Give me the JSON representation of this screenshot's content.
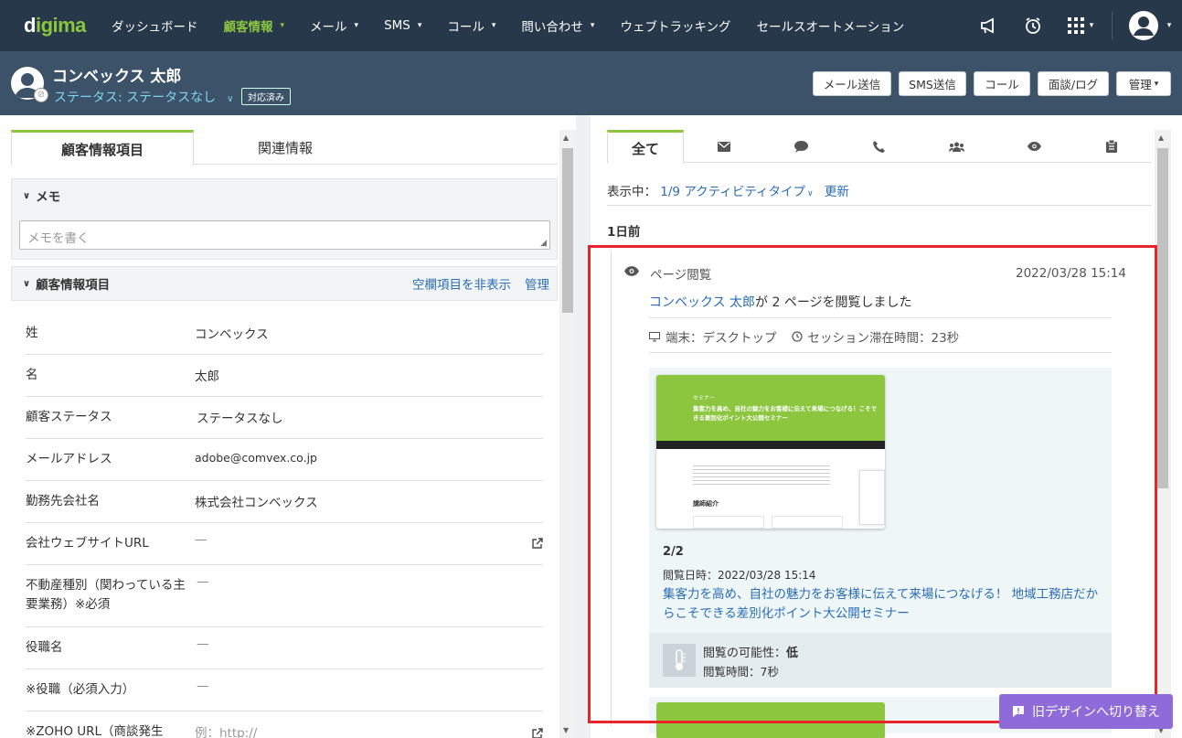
{
  "nav": {
    "logo_a": "d",
    "logo_b": "igima",
    "items": [
      {
        "label": "ダッシュボード"
      },
      {
        "label": "顧客情報"
      },
      {
        "label": "メール"
      },
      {
        "label": "SMS"
      },
      {
        "label": "コール"
      },
      {
        "label": "問い合わせ"
      },
      {
        "label": "ウェブトラッキング"
      },
      {
        "label": "セールスオートメーション"
      }
    ]
  },
  "header": {
    "name": "コンベックス 太郎",
    "status": "ステータス: ステータスなし",
    "badge": "対応済み",
    "buttons": [
      "メール送信",
      "SMS送信",
      "コール",
      "面談/ログ",
      "管理"
    ]
  },
  "left": {
    "tabs": [
      "顧客情報項目",
      "関連情報"
    ],
    "memo_title": "メモ",
    "memo_placeholder": "メモを書く",
    "info_title": "顧客情報項目",
    "hide_empty": "空欄項目を非表示",
    "manage": "管理",
    "fields": [
      {
        "label": "姓",
        "value": "コンベックス"
      },
      {
        "label": "名",
        "value": "太郎"
      },
      {
        "label": "顧客ステータス",
        "value": "ステータスなし"
      },
      {
        "label": "メールアドレス",
        "value": "adobe@comvex.co.jp"
      },
      {
        "label": "勤務先会社名",
        "value": "株式会社コンベックス"
      },
      {
        "label": "会社ウェブサイトURL",
        "value": "—"
      },
      {
        "label": "不動産種別（関わっている主要業務）※必須",
        "value": "—"
      },
      {
        "label": "役職名",
        "value": "—"
      },
      {
        "label": "※役職（必須入力）",
        "value": "—"
      },
      {
        "label": "※ZOHO URL（商談発生",
        "value": "例：http://"
      }
    ]
  },
  "right": {
    "tab_all": "全て",
    "showing_label": "表示中：",
    "showing_value": "1/9 アクティビティタイプ",
    "refresh": "更新",
    "day": "1日前",
    "activity": {
      "type": "ページ閲覧",
      "datetime": "2022/03/28 15:14",
      "who": "コンベックス 太郎",
      "summary": "が 2 ページを閲覧しました",
      "device": "端末：デスクトップ",
      "session": "セッション滞在時間：23秒",
      "page_index": "2/2",
      "viewed_at": "閲覧日時：2022/03/28 15:14",
      "page_title": "集客力を高め、自社の魅力をお客様に伝えて来場につなげる！ 地域工務店だからこそできる差別化ポイント大公開セミナー",
      "likelihood_label": "閲覧の可能性：",
      "likelihood_value": "低",
      "duration": "閲覧時間：7秒",
      "thumb_tag": "セミナー",
      "thumb_title": "集客力を高め、自社の魅力をお客様に伝えて来場につなげる！こそできる差別化ポイント大公開セミナー",
      "thumb_heading": "講師紹介"
    }
  },
  "switch_button": "旧デザインへ切り替え",
  "colors": {
    "nav_bg": "#27384a",
    "header_bg": "#3b5268",
    "accent_green": "#8cc63f",
    "link_blue": "#2a6db5",
    "highlight_red": "#e8242a",
    "purple": "#8e6bd8"
  }
}
